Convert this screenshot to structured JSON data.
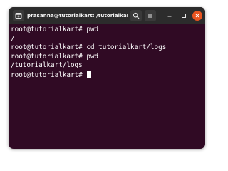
{
  "window": {
    "title": "prasanna@tutorialkart: /tutorialkart"
  },
  "titlebar": {
    "new_tab_icon": "terminal-new-tab-icon",
    "search_icon": "search-icon",
    "menu_icon": "hamburger-menu-icon",
    "minimize_icon": "minimize-icon",
    "maximize_icon": "maximize-icon",
    "close_icon": "close-icon"
  },
  "terminal": {
    "lines": [
      "root@tutorialkart# pwd",
      "/",
      "root@tutorialkart# cd tutorialkart/logs",
      "root@tutorialkart# pwd",
      "/tutorialkart/logs"
    ],
    "prompt": "root@tutorialkart# "
  },
  "colors": {
    "terminal_background": "#300a24",
    "titlebar_background": "#2c2c2c",
    "close_button": "#e95420",
    "text": "#ffffff"
  }
}
